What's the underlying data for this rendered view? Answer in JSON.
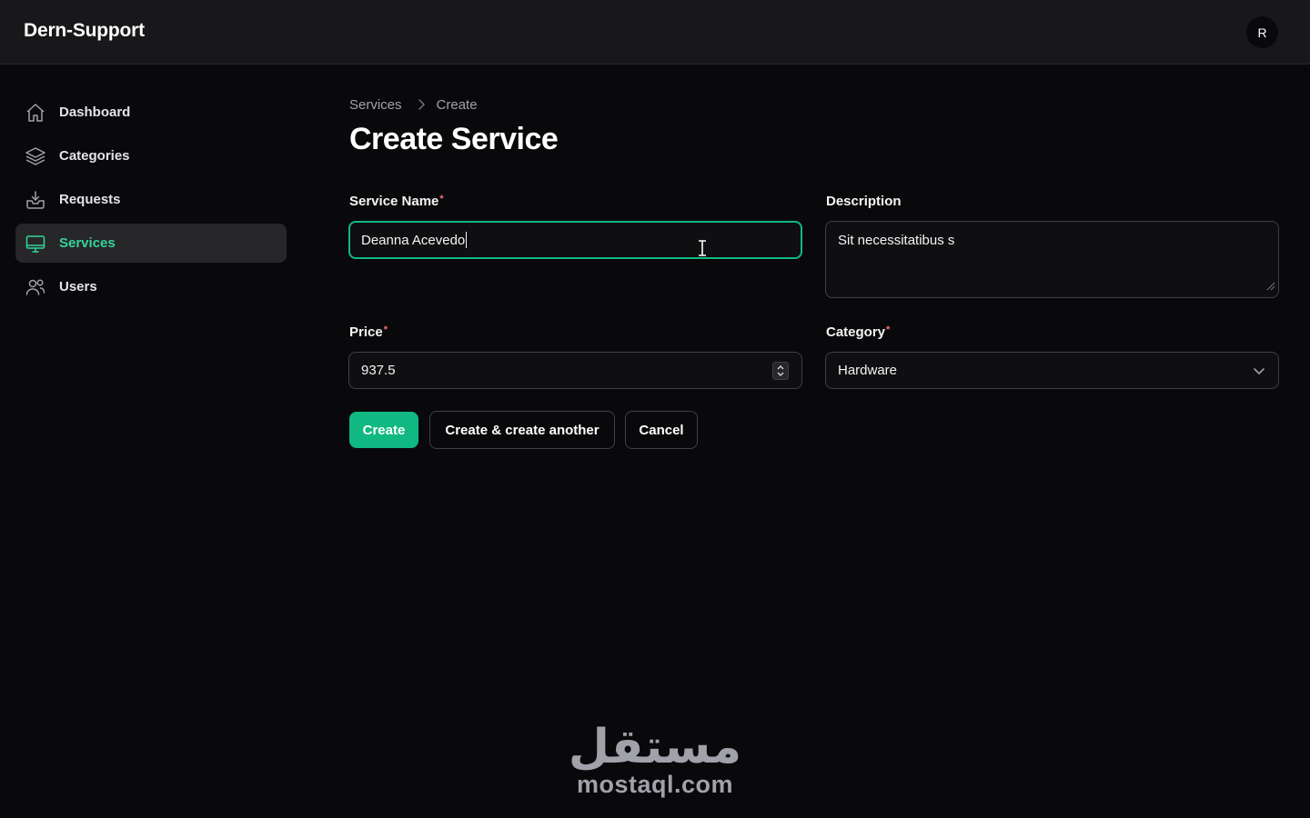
{
  "app": {
    "brand": "Dern-Support",
    "user_initial": "R"
  },
  "sidebar": {
    "items": [
      {
        "label": "Dashboard",
        "icon": "home-icon"
      },
      {
        "label": "Categories",
        "icon": "layers-icon"
      },
      {
        "label": "Requests",
        "icon": "inbox-icon"
      },
      {
        "label": "Services",
        "icon": "monitor-icon",
        "active": true
      },
      {
        "label": "Users",
        "icon": "users-icon"
      }
    ]
  },
  "breadcrumb": {
    "parent": "Services",
    "current": "Create"
  },
  "page": {
    "title": "Create Service"
  },
  "form": {
    "service_name": {
      "label": "Service Name",
      "required_mark": "*",
      "value": "Deanna Acevedo"
    },
    "description": {
      "label": "Description",
      "value": "Sit necessitatibus s"
    },
    "price": {
      "label": "Price",
      "required_mark": "*",
      "value": "937.5"
    },
    "category": {
      "label": "Category",
      "required_mark": "*",
      "value": "Hardware"
    }
  },
  "actions": {
    "create": "Create",
    "create_another": "Create & create another",
    "cancel": "Cancel"
  },
  "watermark": {
    "arabic": "مستقل",
    "latin": "mostaql.com"
  },
  "colors": {
    "accent": "#10b981",
    "background": "#09090b",
    "topbar": "#18181b",
    "required": "#f87171"
  }
}
